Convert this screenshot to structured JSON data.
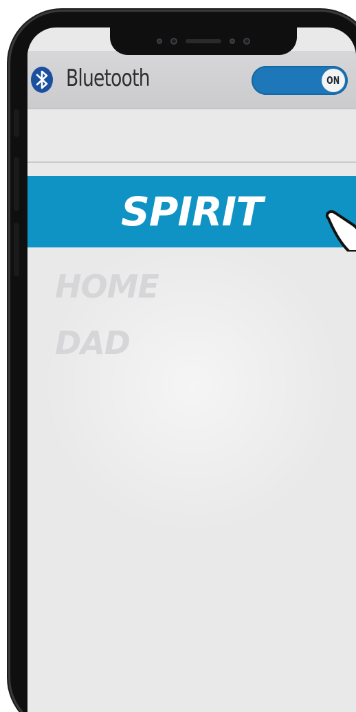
{
  "header": {
    "title": "Bluetooth",
    "toggle_label": "ON",
    "toggle_state": "on",
    "icon": "bluetooth-icon"
  },
  "devices": {
    "selected": "SPIRIT",
    "items": [
      "HOME",
      "DAD"
    ]
  },
  "colors": {
    "accent": "#0e93c4",
    "toggle": "#1d77b8",
    "bluetooth_icon": "#1b4fa0",
    "screen_bg": "#e9e9e9",
    "header_bg": "#cfcfd1",
    "inactive_text": "#d6d6d8"
  },
  "icons": {
    "pointer": "hand-pointer-icon"
  }
}
